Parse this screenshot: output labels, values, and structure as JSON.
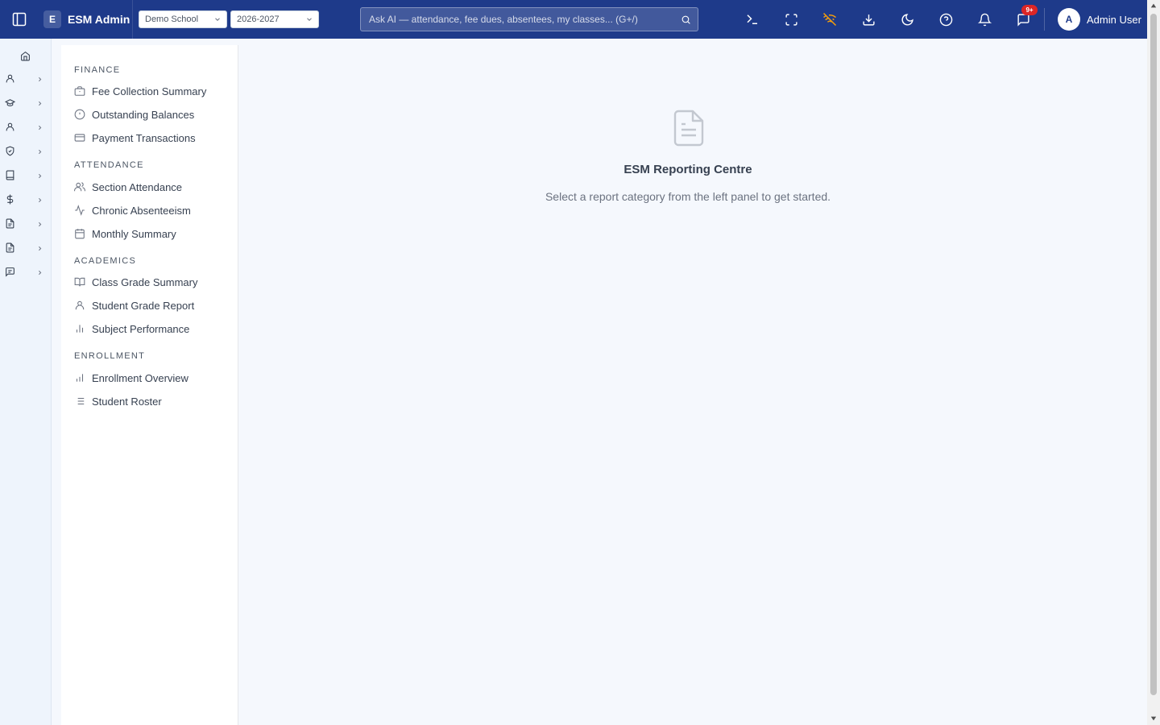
{
  "header": {
    "brand_letter": "E",
    "brand_name": "ESM Admin",
    "school_select": "Demo School",
    "year_select": "2026-2027",
    "search_placeholder": "Ask AI — attendance, fee dues, absentees, my classes... (G+/)",
    "messages_badge": "9+",
    "user_initial": "A",
    "user_name": "Admin User",
    "icons": [
      "sidebar-toggle-icon",
      "terminal-icon",
      "fullscreen-icon",
      "wifi-off-icon",
      "download-icon",
      "moon-icon",
      "help-icon",
      "bell-icon",
      "chat-icon"
    ]
  },
  "rail": {
    "items": [
      "home-icon",
      "user-icon",
      "graduation-cap-icon",
      "user-icon",
      "shield-icon",
      "book-icon",
      "dollar-icon",
      "document-icon",
      "document-icon",
      "message-icon"
    ]
  },
  "reports": {
    "sections": [
      {
        "title": "FINANCE",
        "items": [
          {
            "label": "Fee Collection Summary",
            "icon": "briefcase-icon"
          },
          {
            "label": "Outstanding Balances",
            "icon": "alert-circle-icon"
          },
          {
            "label": "Payment Transactions",
            "icon": "credit-card-icon"
          }
        ]
      },
      {
        "title": "ATTENDANCE",
        "items": [
          {
            "label": "Section Attendance",
            "icon": "users-icon"
          },
          {
            "label": "Chronic Absenteeism",
            "icon": "activity-icon"
          },
          {
            "label": "Monthly Summary",
            "icon": "calendar-icon"
          }
        ]
      },
      {
        "title": "ACADEMICS",
        "items": [
          {
            "label": "Class Grade Summary",
            "icon": "open-book-icon"
          },
          {
            "label": "Student Grade Report",
            "icon": "user-icon"
          },
          {
            "label": "Subject Performance",
            "icon": "bar-chart-icon"
          }
        ]
      },
      {
        "title": "ENROLLMENT",
        "items": [
          {
            "label": "Enrollment Overview",
            "icon": "bar-chart-icon"
          },
          {
            "label": "Student Roster",
            "icon": "list-icon"
          }
        ]
      }
    ]
  },
  "main": {
    "title": "ESM Reporting Centre",
    "subtitle": "Select a report category from the left panel to get started."
  },
  "colors": {
    "topbar": "#1e3a8a",
    "background": "#f5f8fd",
    "badge": "#dc2626",
    "wifi_off": "#f59e0b"
  }
}
